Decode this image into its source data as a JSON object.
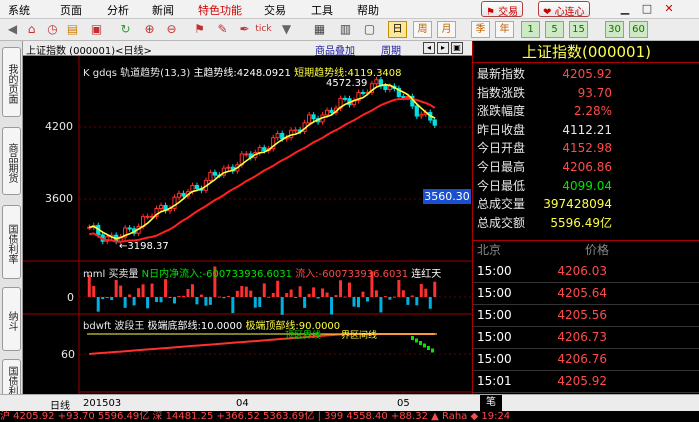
{
  "menubar": {
    "items": [
      "系统",
      "页面",
      "分析",
      "新闻",
      "特色功能",
      "交易",
      "工具",
      "帮助"
    ],
    "trade_button": "交易",
    "heart_button": "心连心"
  },
  "toolbar": {
    "periods": [
      "日",
      "周",
      "月",
      "季",
      "年",
      "1",
      "5",
      "15",
      "30",
      "60"
    ],
    "selected_period": "日"
  },
  "sidetabs": [
    "我的页面",
    "商品期货",
    "国债利率",
    "纳斗",
    "国债利率"
  ],
  "chart": {
    "title": "上证指数 (000001)<日线>",
    "overlay_link": "商品叠加",
    "period_link": "周期",
    "main_label": "K  gdqs 轨道趋势(13,3)",
    "main_trend": "主趋势线:4248.0921",
    "short_trend": "短期趋势线:4119.3408",
    "y_labels": [
      "4200",
      "3600"
    ],
    "high_label": "4572.39",
    "low_label": "←3198.37",
    "price_tag": "3560.30",
    "vol_title": "mml 买卖量",
    "vol_in": "N日内净流入:-600733936.6031",
    "vol_in2": "流入:-600733936.6031",
    "vol_extra": "连红天",
    "vol_zero": "0",
    "osc_title": "bdwft 波段王",
    "osc_low": "极端底部线:10.0000",
    "osc_high": "极端顶部线:90.0000",
    "osc_60": "60",
    "osc_zone_a": "顶区界线",
    "osc_zone_b": "界区间线",
    "x_labels": [
      "201503",
      "04",
      "05"
    ]
  },
  "chart_data": {
    "type": "line",
    "title": "上证指数 (000001)<日线>",
    "x": [
      "201503",
      "04",
      "05"
    ],
    "series": [
      {
        "name": "主趋势线",
        "last": 4248.0921
      },
      {
        "name": "短期趋势线",
        "last": 4119.3408
      }
    ],
    "high": 4572.39,
    "low": 3198.37,
    "y_ticks": [
      4200,
      3600
    ],
    "volume_net_inflow": -600733936.6031,
    "osc_bounds": [
      10,
      90
    ]
  },
  "quote": {
    "title": "上证指数(000001)",
    "rows": [
      {
        "label": "最新指数",
        "value": "4205.92",
        "color": "red"
      },
      {
        "label": "指数涨跌",
        "value": "93.70",
        "color": "red"
      },
      {
        "label": "涨跌幅度",
        "value": "2.28%",
        "color": "red"
      },
      {
        "label": "昨日收盘",
        "value": "4112.21",
        "color": "white"
      },
      {
        "label": "今日开盘",
        "value": "4152.98",
        "color": "red"
      },
      {
        "label": "今日最高",
        "value": "4206.86",
        "color": "red"
      },
      {
        "label": "今日最低",
        "value": "4099.04",
        "color": "green"
      },
      {
        "label": "总成交量",
        "value": "397428094",
        "color": "yellow"
      },
      {
        "label": "总成交额",
        "value": "5596.49亿",
        "color": "yellow"
      }
    ],
    "tick_header": {
      "place": "北京",
      "price": "价格"
    },
    "ticks": [
      {
        "time": "15:00",
        "price": "4206.03"
      },
      {
        "time": "15:00",
        "price": "4205.64"
      },
      {
        "time": "15:00",
        "price": "4205.56"
      },
      {
        "time": "15:00",
        "price": "4206.73"
      },
      {
        "time": "15:00",
        "price": "4206.76"
      },
      {
        "time": "15:01",
        "price": "4205.92"
      }
    ]
  },
  "bottom": {
    "tab_daily": "日线",
    "tab_pen": "笔"
  },
  "ticker": "沪  4205.92  +93.70  5596.49亿   深  14481.25  +366.52  5363.69亿   |  399  4558.40  +88.32  ▲ Raha  ◆  19:24"
}
